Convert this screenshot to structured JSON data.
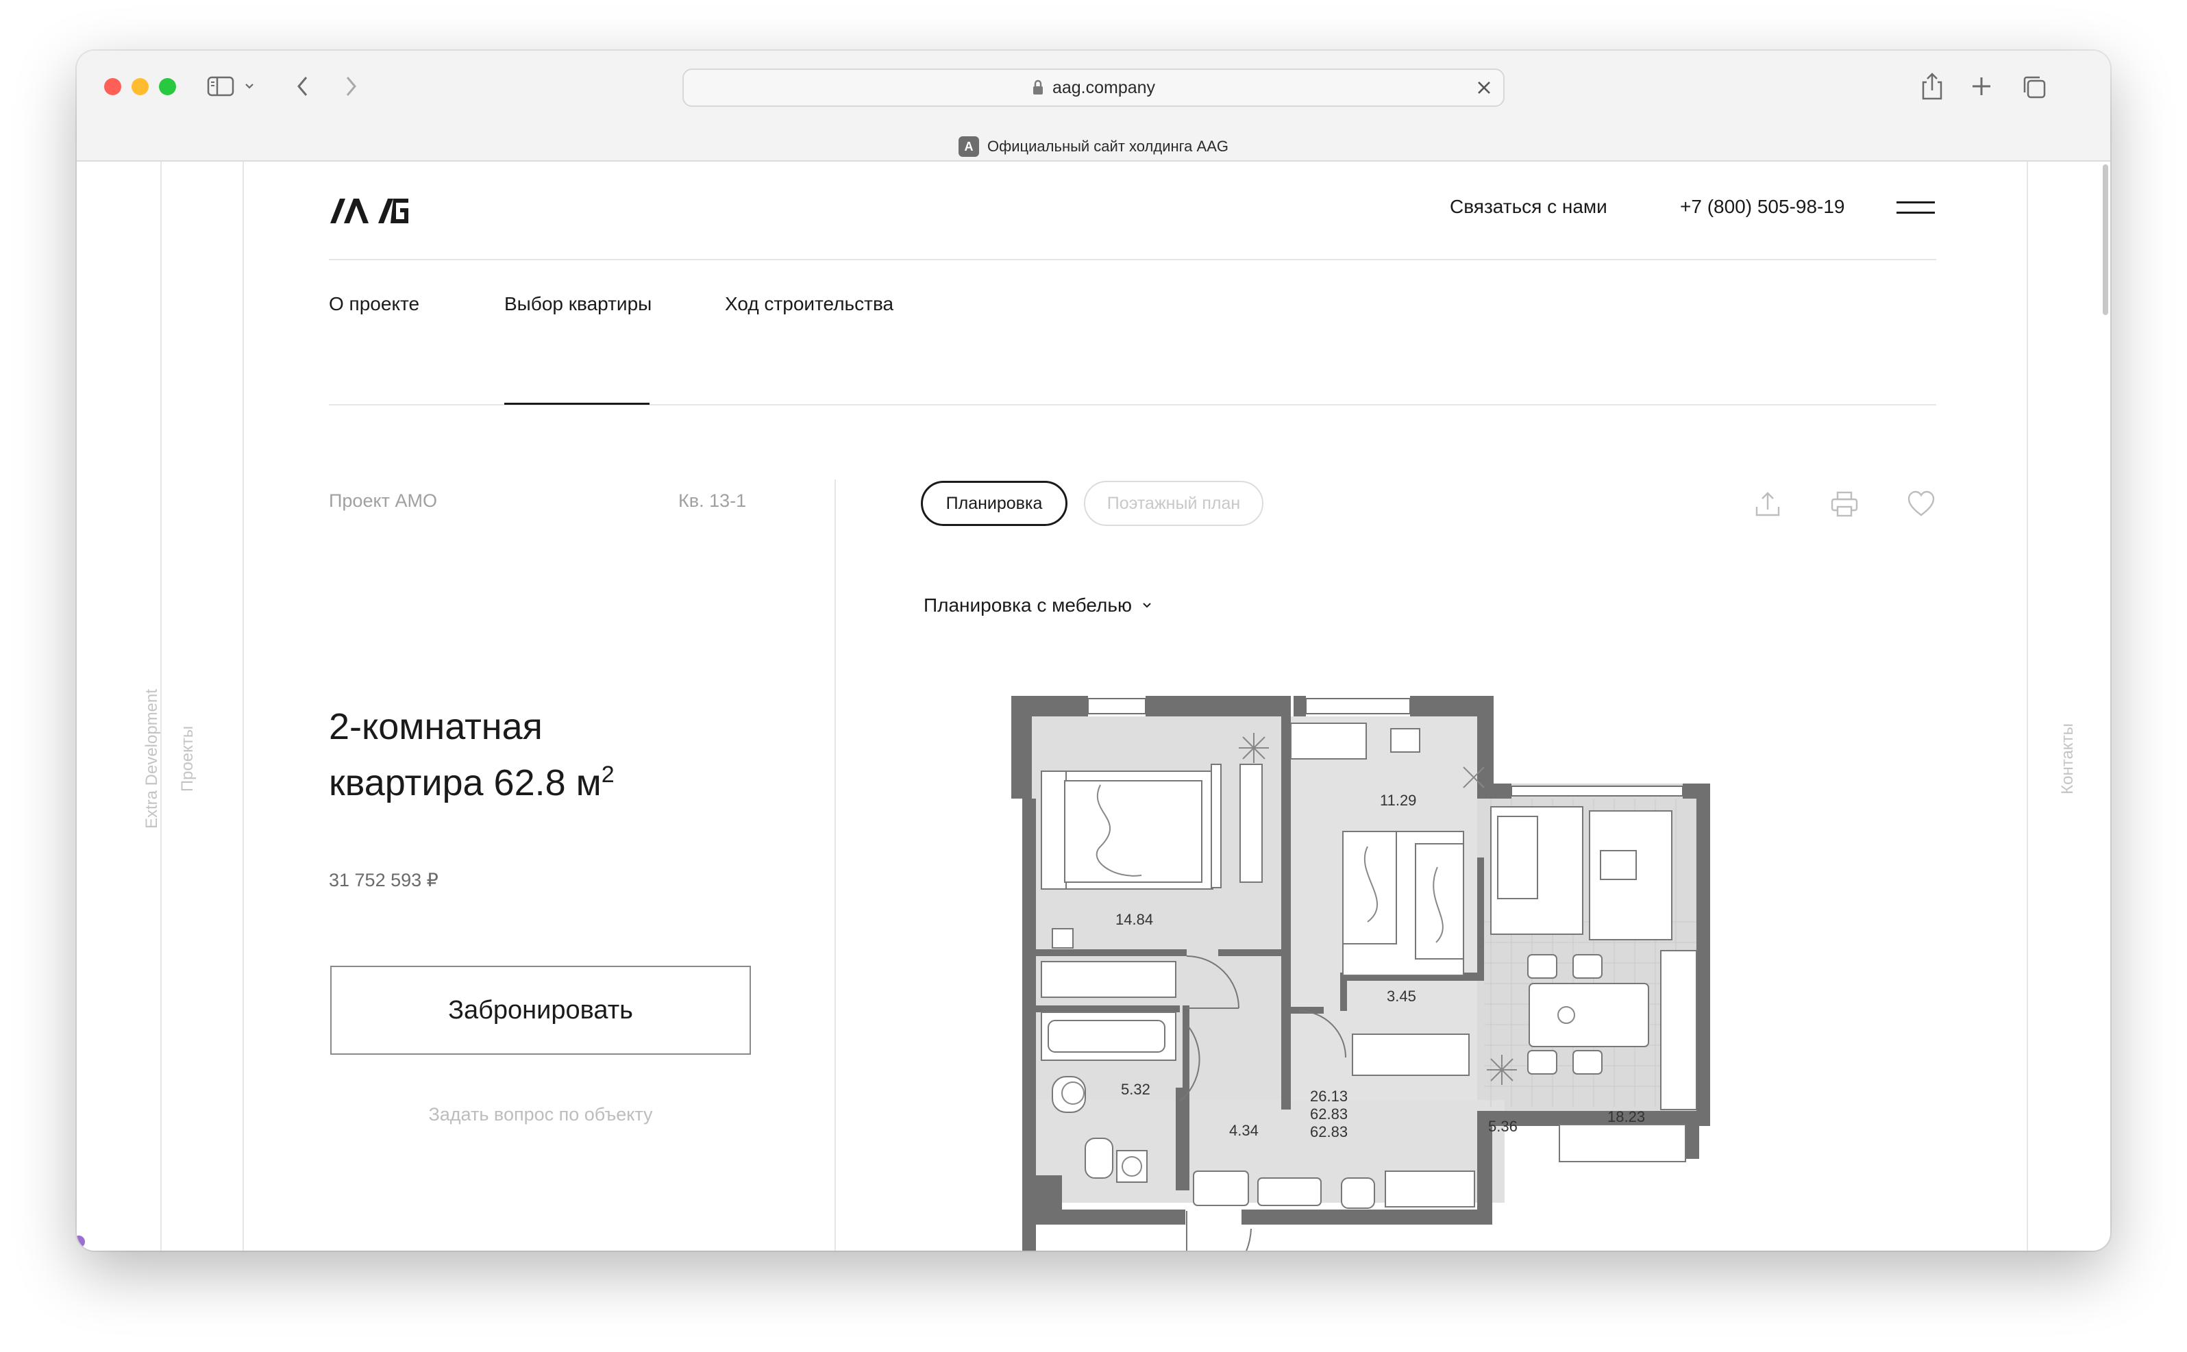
{
  "browser": {
    "url": "aag.company",
    "tab_title": "Официальный сайт холдинга AAG",
    "tab_favicon_letter": "A"
  },
  "side": {
    "left_outer": "Extra Development",
    "left_inner": "Проекты",
    "right": "Контакты"
  },
  "header": {
    "logo": "AAG",
    "contact_label": "Связаться с нами",
    "phone": "+7 (800) 505-98-19"
  },
  "nav": {
    "items": [
      "О проекте",
      "Выбор квартиры",
      "Ход строительства"
    ],
    "active": "Выбор квартиры"
  },
  "apartment": {
    "project": "Проект АМО",
    "number": "Кв. 13-1",
    "title_line1": "2-комнатная",
    "title_line2": "квартира 62.8 м",
    "title_sup": "2",
    "price": "31 752 593 ₽",
    "book_label": "Забронировать",
    "ask_label": "Задать вопрос по объекту"
  },
  "plan_view": {
    "toggle": [
      "Планировка",
      "Поэтажный план"
    ],
    "active_toggle": "Планировка",
    "dropdown_label": "Планировка с мебелью",
    "rooms": [
      "14.84",
      "11.29",
      "3.45",
      "5.32",
      "4.34",
      "26.13",
      "62.83",
      "62.83",
      "5.36",
      "18.23"
    ]
  },
  "icons": [
    "sidebar-icon",
    "chevron-down-icon",
    "back-icon",
    "forward-icon",
    "lock-icon",
    "close-icon",
    "share-icon",
    "plus-icon",
    "tabs-icon",
    "menu-icon",
    "upload-icon",
    "print-icon",
    "heart-icon"
  ],
  "colors": {
    "text": "#1a1a1a",
    "muted": "#a0a0a0",
    "wall": "#707070",
    "floor": "#dcdcdc"
  }
}
